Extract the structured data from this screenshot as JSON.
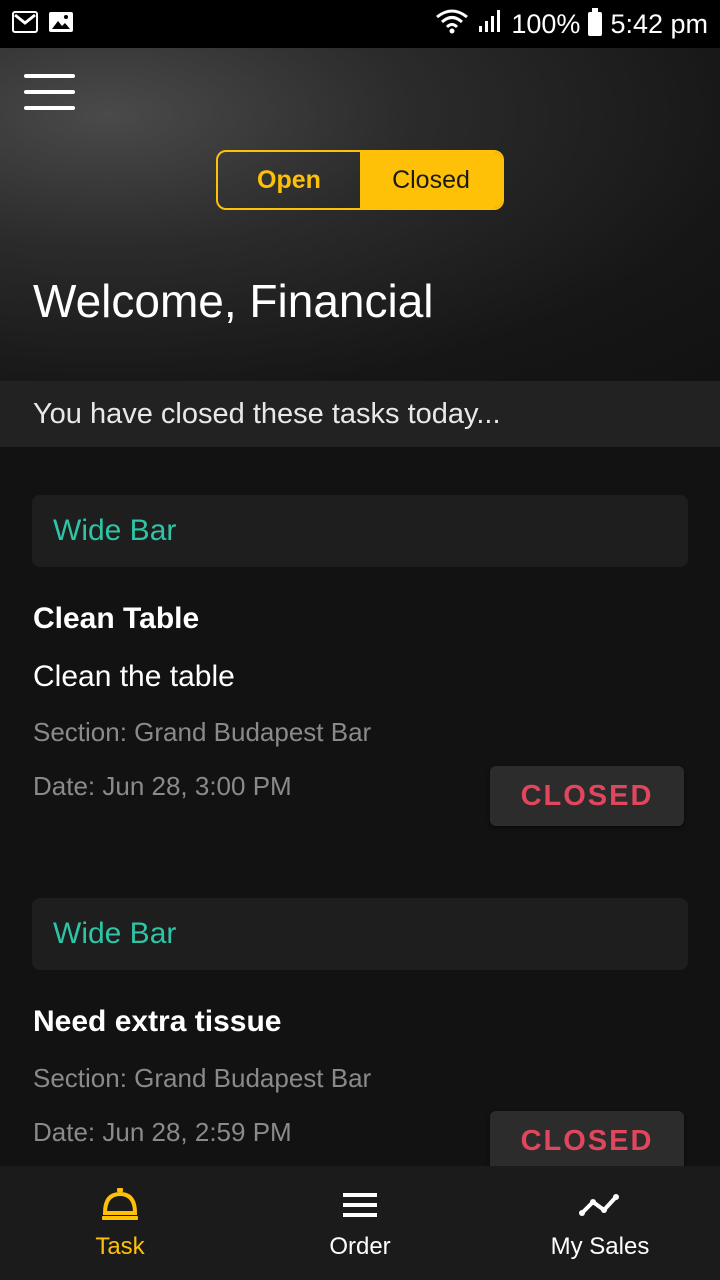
{
  "status_bar": {
    "signal_text": "100%",
    "time": "5:42 pm"
  },
  "header": {
    "toggle": {
      "open_label": "Open",
      "closed_label": "Closed",
      "selected": "Closed"
    },
    "welcome": "Welcome, Financial"
  },
  "subheader": "You have closed these tasks today...",
  "tasks": [
    {
      "location": "Wide Bar",
      "title": "Clean Table",
      "description": "Clean the table",
      "section": "Section: Grand Budapest Bar",
      "date": "Date: Jun 28, 3:00 PM",
      "status": "CLOSED"
    },
    {
      "location": "Wide Bar",
      "title": "Need extra tissue",
      "section": "Section: Grand Budapest Bar",
      "date": "Date: Jun 28, 2:59 PM",
      "status": "CLOSED"
    }
  ],
  "bottom_nav": {
    "items": [
      {
        "label": "Task",
        "icon": "bell-icon",
        "active": true
      },
      {
        "label": "Order",
        "icon": "list-icon",
        "active": false
      },
      {
        "label": "My Sales",
        "icon": "chart-line-icon",
        "active": false
      }
    ]
  },
  "colors": {
    "accent": "#FFC107",
    "location": "#2EC4A6",
    "closed": "#E0475C"
  }
}
